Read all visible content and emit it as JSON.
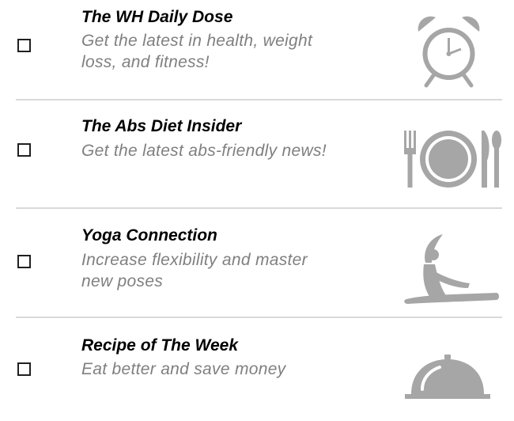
{
  "newsletters": [
    {
      "title": "The WH Daily Dose",
      "description_line1": "Get the latest in health, weight",
      "description_line2": "loss, and fitness!",
      "icon": "alarm-clock-icon",
      "checked": false
    },
    {
      "title": "The Abs Diet Insider",
      "description_line1": "Get the latest abs-friendly news!",
      "description_line2": "",
      "icon": "plate-utensils-icon",
      "checked": false
    },
    {
      "title": "Yoga Connection",
      "description_line1": "Increase flexibility and master",
      "description_line2": "new poses",
      "icon": "yoga-pose-icon",
      "checked": false
    },
    {
      "title": "Recipe of The Week",
      "description_line1": "Eat better and save money",
      "description_line2": "",
      "icon": "cloche-icon",
      "checked": false
    }
  ],
  "colors": {
    "title": "#000000",
    "description": "#7f7f7f",
    "icon": "#a6a6a6",
    "divider": "#d9d9d9",
    "checkbox_border": "#202020"
  }
}
